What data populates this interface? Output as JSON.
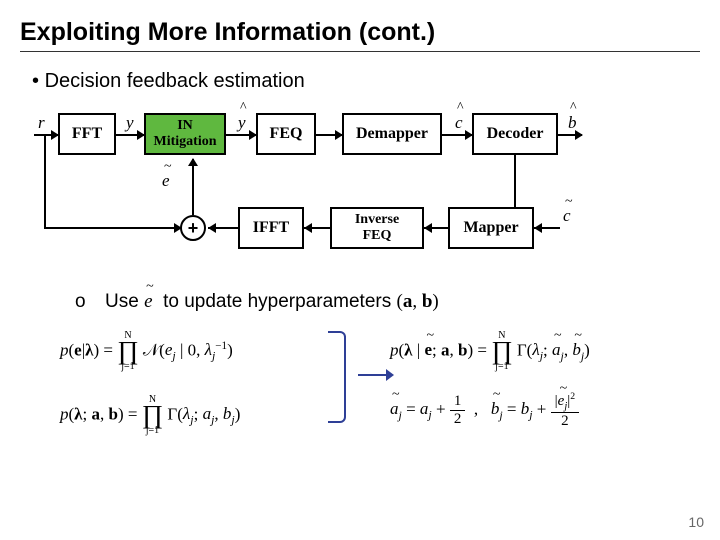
{
  "title": "Exploiting More Information (cont.)",
  "bullet": "Decision feedback estimation",
  "blocks": {
    "fft": "FFT",
    "in1": "IN\nMitigation",
    "feq": "FEQ",
    "demapper": "Demapper",
    "decoder": "Decoder",
    "mapper": "Mapper",
    "invfeq": "Inverse\nFEQ",
    "ifft": "IFFT"
  },
  "signals": {
    "r": "r",
    "y": "y",
    "yhat": "y",
    "chat": "c",
    "bhat": "b",
    "ctilde": "c",
    "etilde": "e"
  },
  "sub": {
    "marker": "o",
    "t1": "Use",
    "e": "e",
    "t2": "to update hyperparameters"
  },
  "eq": {
    "N": "N",
    "j1": "j=1",
    "half_n": "1",
    "half_d": "2"
  },
  "page": "10"
}
